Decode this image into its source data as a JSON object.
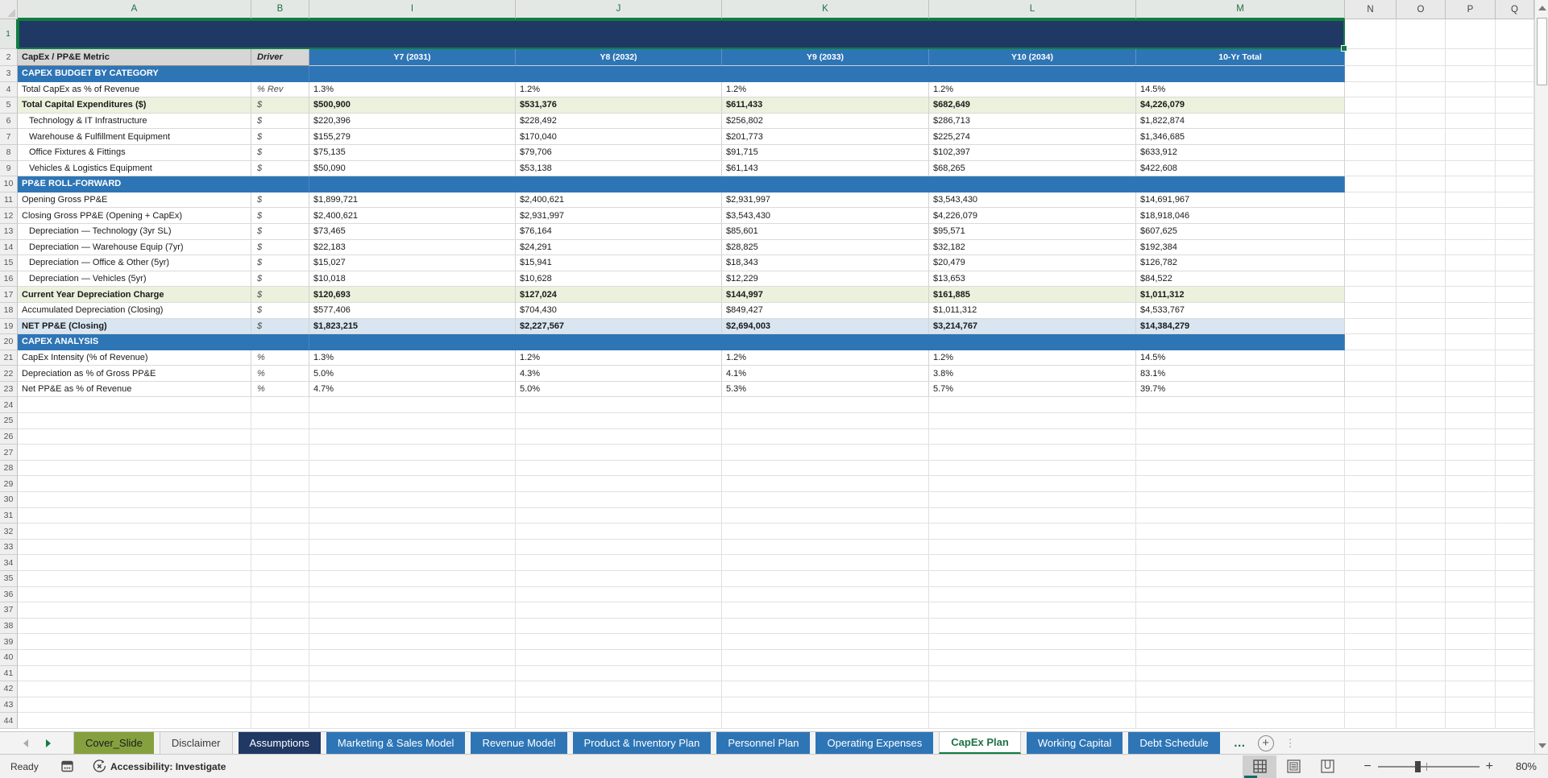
{
  "app": {
    "name": "excel-spreadsheet"
  },
  "colors": {
    "accent_green": "#107C41",
    "navy": "#1F3864",
    "header_blue": "#2E75B6",
    "band_green": "#EBF1DD",
    "band_blue": "#D9E6F2",
    "header_gray": "#D6D6D6",
    "tab_olive": "#85A03E"
  },
  "grid": {
    "column_letters": [
      "A",
      "B",
      "I",
      "J",
      "K",
      "L",
      "M",
      "N",
      "O",
      "P",
      "Q"
    ],
    "selected_column_count": 7,
    "row_count": 44,
    "header_row": {
      "row": 2,
      "metric": "CapEx / PP&E Metric",
      "driver": "Driver",
      "years": [
        "Y7 (2031)",
        "Y8 (2032)",
        "Y9 (2033)",
        "Y10 (2034)",
        "10-Yr Total"
      ]
    },
    "rows": [
      {
        "n": 3,
        "section": "CAPEX BUDGET BY CATEGORY"
      },
      {
        "n": 4,
        "label": "Total CapEx as % of Revenue",
        "driver": "% Rev",
        "values": [
          "1.3%",
          "1.2%",
          "1.2%",
          "1.2%",
          "14.5%"
        ]
      },
      {
        "n": 5,
        "label": "Total Capital Expenditures ($)",
        "driver": "$",
        "style": "green",
        "bold": true,
        "values": [
          "$500,900",
          "$531,376",
          "$611,433",
          "$682,649",
          "$4,226,079"
        ]
      },
      {
        "n": 6,
        "label": "Technology & IT Infrastructure",
        "driver": "$",
        "indent": true,
        "values": [
          "$220,396",
          "$228,492",
          "$256,802",
          "$286,713",
          "$1,822,874"
        ]
      },
      {
        "n": 7,
        "label": "Warehouse & Fulfillment Equipment",
        "driver": "$",
        "indent": true,
        "values": [
          "$155,279",
          "$170,040",
          "$201,773",
          "$225,274",
          "$1,346,685"
        ]
      },
      {
        "n": 8,
        "label": "Office Fixtures & Fittings",
        "driver": "$",
        "indent": true,
        "values": [
          "$75,135",
          "$79,706",
          "$91,715",
          "$102,397",
          "$633,912"
        ]
      },
      {
        "n": 9,
        "label": "Vehicles & Logistics Equipment",
        "driver": "$",
        "indent": true,
        "values": [
          "$50,090",
          "$53,138",
          "$61,143",
          "$68,265",
          "$422,608"
        ]
      },
      {
        "n": 10,
        "section": "PP&E ROLL-FORWARD"
      },
      {
        "n": 11,
        "label": "Opening Gross PP&E",
        "driver": "$",
        "values": [
          "$1,899,721",
          "$2,400,621",
          "$2,931,997",
          "$3,543,430",
          "$14,691,967"
        ]
      },
      {
        "n": 12,
        "label": "Closing Gross PP&E (Opening + CapEx)",
        "driver": "$",
        "values": [
          "$2,400,621",
          "$2,931,997",
          "$3,543,430",
          "$4,226,079",
          "$18,918,046"
        ]
      },
      {
        "n": 13,
        "label": "Depreciation — Technology (3yr SL)",
        "driver": "$",
        "indent": true,
        "values": [
          "$73,465",
          "$76,164",
          "$85,601",
          "$95,571",
          "$607,625"
        ]
      },
      {
        "n": 14,
        "label": "Depreciation — Warehouse Equip (7yr)",
        "driver": "$",
        "indent": true,
        "values": [
          "$22,183",
          "$24,291",
          "$28,825",
          "$32,182",
          "$192,384"
        ]
      },
      {
        "n": 15,
        "label": "Depreciation — Office & Other (5yr)",
        "driver": "$",
        "indent": true,
        "values": [
          "$15,027",
          "$15,941",
          "$18,343",
          "$20,479",
          "$126,782"
        ]
      },
      {
        "n": 16,
        "label": "Depreciation — Vehicles (5yr)",
        "driver": "$",
        "indent": true,
        "values": [
          "$10,018",
          "$10,628",
          "$12,229",
          "$13,653",
          "$84,522"
        ]
      },
      {
        "n": 17,
        "label": "Current Year Depreciation Charge",
        "driver": "$",
        "style": "green",
        "bold": true,
        "values": [
          "$120,693",
          "$127,024",
          "$144,997",
          "$161,885",
          "$1,011,312"
        ]
      },
      {
        "n": 18,
        "label": "Accumulated Depreciation (Closing)",
        "driver": "$",
        "values": [
          "$577,406",
          "$704,430",
          "$849,427",
          "$1,011,312",
          "$4,533,767"
        ]
      },
      {
        "n": 19,
        "label": "NET PP&E (Closing)",
        "driver": "$",
        "style": "blue",
        "bold": true,
        "values": [
          "$1,823,215",
          "$2,227,567",
          "$2,694,003",
          "$3,214,767",
          "$14,384,279"
        ]
      },
      {
        "n": 20,
        "section": "CAPEX ANALYSIS"
      },
      {
        "n": 21,
        "label": "CapEx Intensity (% of Revenue)",
        "driver": "%",
        "values": [
          "1.3%",
          "1.2%",
          "1.2%",
          "1.2%",
          "14.5%"
        ]
      },
      {
        "n": 22,
        "label": "Depreciation as % of Gross PP&E",
        "driver": "%",
        "values": [
          "5.0%",
          "4.3%",
          "4.1%",
          "3.8%",
          "83.1%"
        ]
      },
      {
        "n": 23,
        "label": "Net PP&E as % of Revenue",
        "driver": "%",
        "values": [
          "4.7%",
          "5.0%",
          "5.3%",
          "5.7%",
          "39.7%"
        ]
      }
    ]
  },
  "sheet_tabs": [
    {
      "label": "Cover_Slide",
      "style": "olive"
    },
    {
      "label": "Disclaimer",
      "style": "light"
    },
    {
      "label": "Assumptions",
      "style": "navy"
    },
    {
      "label": "Marketing & Sales Model",
      "style": "blue"
    },
    {
      "label": "Revenue Model",
      "style": "blue"
    },
    {
      "label": "Product & Inventory Plan",
      "style": "blue"
    },
    {
      "label": "Personnel Plan",
      "style": "blue"
    },
    {
      "label": "Operating Expenses",
      "style": "blue"
    },
    {
      "label": "CapEx Plan",
      "style": "active"
    },
    {
      "label": "Working Capital",
      "style": "blue"
    },
    {
      "label": "Debt Schedule",
      "style": "blue"
    }
  ],
  "tab_tools": {
    "overflow": "…"
  },
  "status_bar": {
    "ready": "Ready",
    "accessibility": "Accessibility: Investigate",
    "zoom_percent": "80%"
  }
}
